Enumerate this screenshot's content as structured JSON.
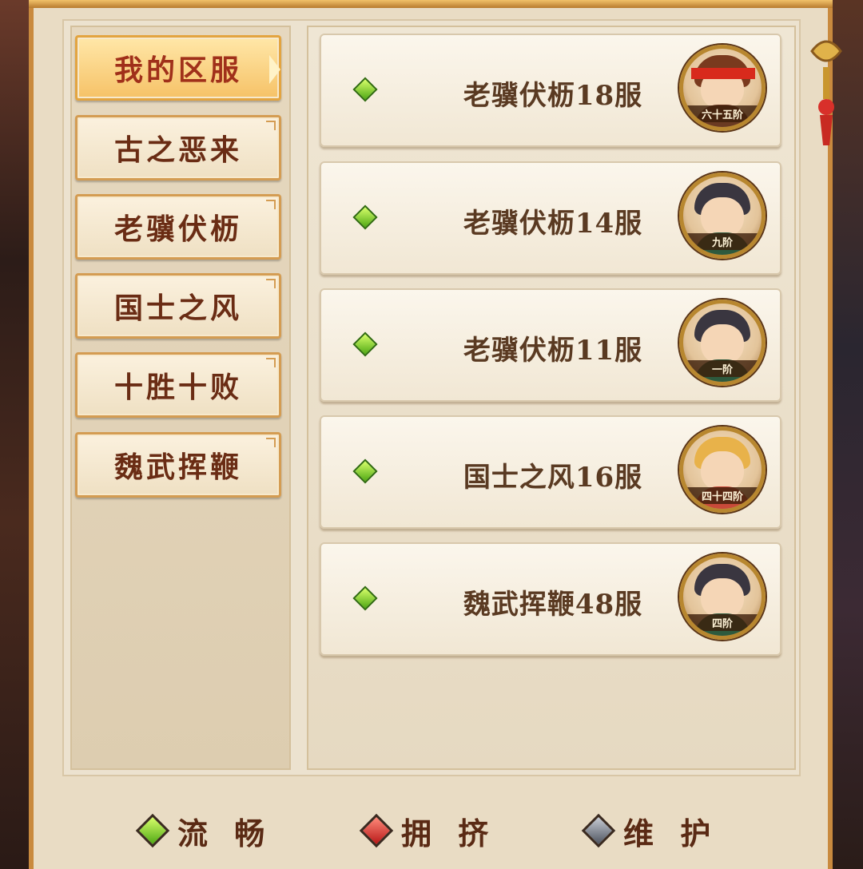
{
  "tabs": [
    {
      "label": "我的区服",
      "active": true
    },
    {
      "label": "古之恶来",
      "active": false
    },
    {
      "label": "老骥伏枥",
      "active": false
    },
    {
      "label": "国士之风",
      "active": false
    },
    {
      "label": "十胜十败",
      "active": false
    },
    {
      "label": "魏武挥鞭",
      "active": false
    }
  ],
  "servers": [
    {
      "name": "老骥伏枥18服",
      "status": "流畅",
      "rank": "六十五阶",
      "avatar": "hero-red-headband"
    },
    {
      "name": "老骥伏枥14服",
      "status": "流畅",
      "rank": "九阶",
      "avatar": "hero-dark-hair"
    },
    {
      "name": "老骥伏枥11服",
      "status": "流畅",
      "rank": "一阶",
      "avatar": "hero-dark-hair"
    },
    {
      "name": "国士之风16服",
      "status": "流畅",
      "rank": "四十四阶",
      "avatar": "hero-blonde"
    },
    {
      "name": "魏武挥鞭48服",
      "status": "流畅",
      "rank": "四阶",
      "avatar": "hero-dark-hair"
    }
  ],
  "legend": {
    "smooth": "流 畅",
    "crowded": "拥 挤",
    "maintenance": "维 护"
  },
  "colors": {
    "smooth": "#6cc21e",
    "crowded": "#d82a1c",
    "maintenance": "#6a707c"
  }
}
